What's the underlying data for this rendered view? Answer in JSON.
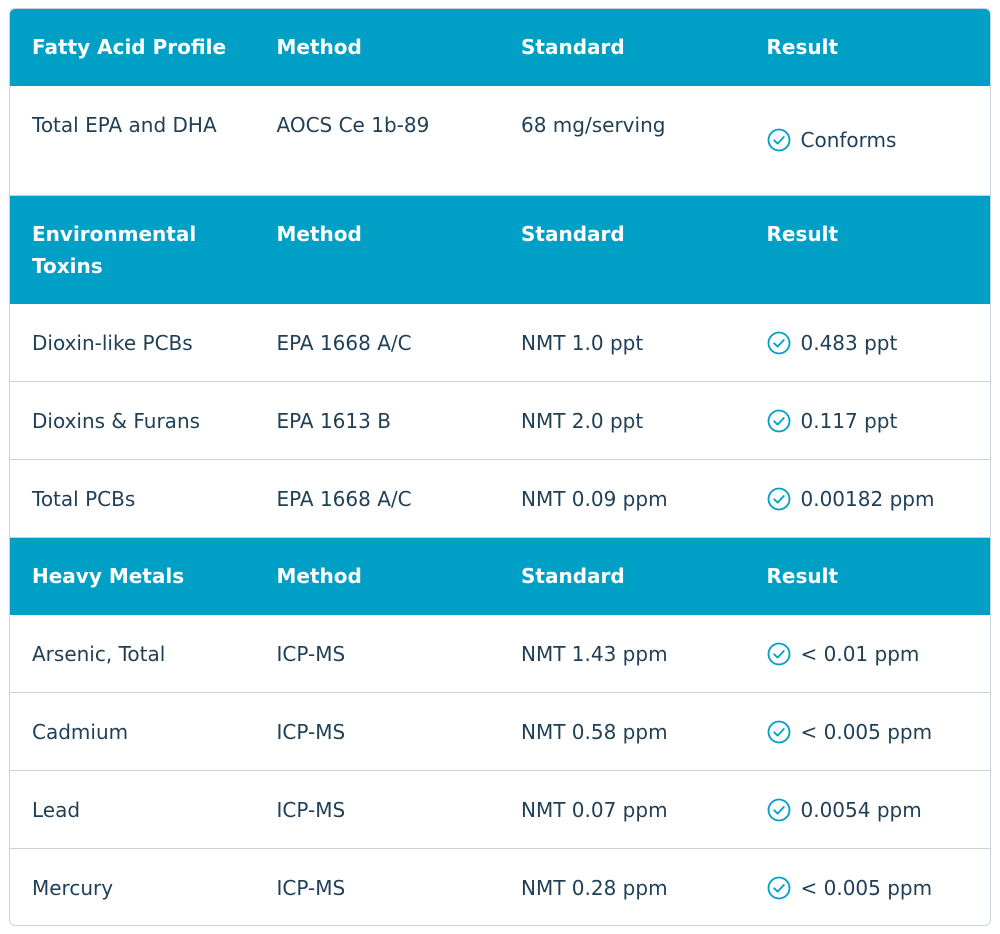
{
  "colors": {
    "header_bg": "#00a0c6",
    "text": "#1f3f57",
    "check": "#00a0c6",
    "border": "#c9d3da"
  },
  "icons": {
    "result_status": "check-circle-icon"
  },
  "sections": [
    {
      "header": [
        "Fatty Acid Profile",
        "Method",
        "Standard",
        "Result"
      ],
      "rows": [
        [
          "Total EPA and DHA",
          "AOCS Ce 1b-89",
          "68 mg/serving",
          "Conforms"
        ]
      ]
    },
    {
      "header": [
        "Environmental Toxins",
        "Method",
        "Standard",
        "Result"
      ],
      "rows": [
        [
          "Dioxin-like PCBs",
          "EPA 1668 A/C",
          "NMT 1.0 ppt",
          "0.483 ppt"
        ],
        [
          "Dioxins & Furans",
          "EPA 1613 B",
          "NMT 2.0 ppt",
          "0.117 ppt"
        ],
        [
          "Total PCBs",
          "EPA 1668 A/C",
          "NMT 0.09 ppm",
          "0.00182 ppm"
        ]
      ]
    },
    {
      "header": [
        "Heavy Metals",
        "Method",
        "Standard",
        "Result"
      ],
      "rows": [
        [
          "Arsenic, Total",
          "ICP-MS",
          "NMT 1.43 ppm",
          "< 0.01 ppm"
        ],
        [
          "Cadmium",
          "ICP-MS",
          "NMT 0.58 ppm",
          "< 0.005 ppm"
        ],
        [
          "Lead",
          "ICP-MS",
          "NMT 0.07 ppm",
          "0.0054 ppm"
        ],
        [
          "Mercury",
          "ICP-MS",
          "NMT 0.28 ppm",
          "< 0.005 ppm"
        ]
      ]
    }
  ]
}
